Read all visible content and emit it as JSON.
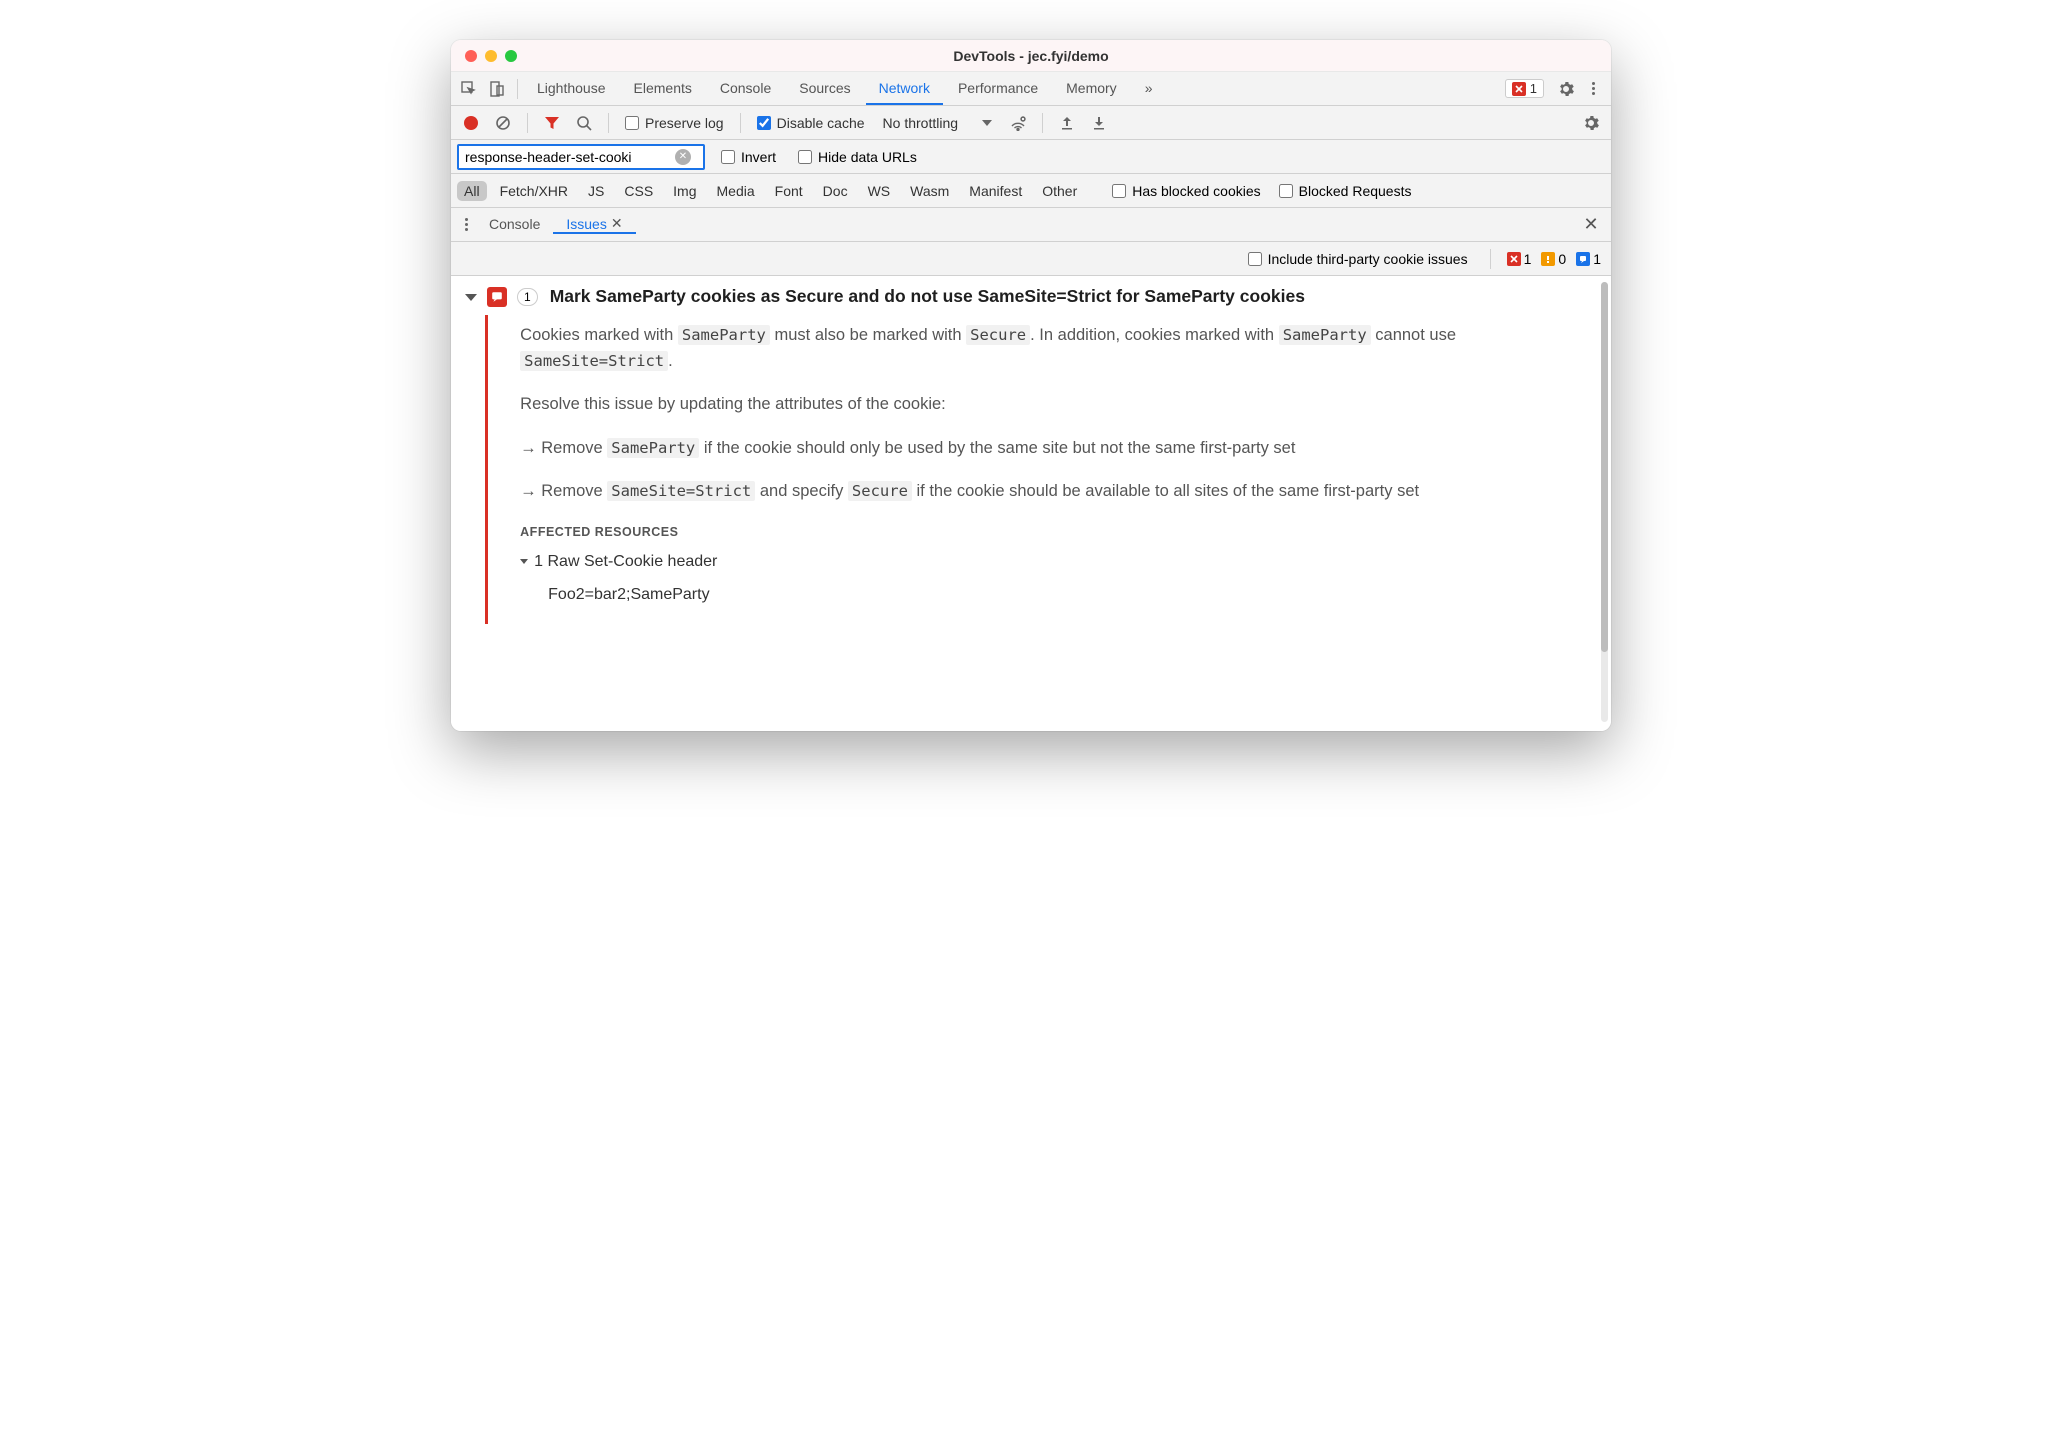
{
  "window": {
    "title": "DevTools - jec.fyi/demo"
  },
  "mainTabs": {
    "items": [
      "Lighthouse",
      "Elements",
      "Console",
      "Sources",
      "Network",
      "Performance",
      "Memory"
    ],
    "active": "Network",
    "overflow": "»",
    "errorCount": "1"
  },
  "networkToolbar": {
    "preserveLog": {
      "label": "Preserve log",
      "checked": false
    },
    "disableCache": {
      "label": "Disable cache",
      "checked": true
    },
    "throttling": "No throttling"
  },
  "filter": {
    "value": "response-header-set-cooki",
    "invert": {
      "label": "Invert",
      "checked": false
    },
    "hideDataUrls": {
      "label": "Hide data URLs",
      "checked": false
    }
  },
  "types": {
    "items": [
      "All",
      "Fetch/XHR",
      "JS",
      "CSS",
      "Img",
      "Media",
      "Font",
      "Doc",
      "WS",
      "Wasm",
      "Manifest",
      "Other"
    ],
    "active": "All",
    "hasBlockedCookies": {
      "label": "Has blocked cookies",
      "checked": false
    },
    "blockedRequests": {
      "label": "Blocked Requests",
      "checked": false
    }
  },
  "drawer": {
    "tabs": [
      "Console",
      "Issues"
    ],
    "active": "Issues"
  },
  "issuesHeader": {
    "includeThirdParty": {
      "label": "Include third-party cookie issues",
      "checked": false
    },
    "counts": {
      "error": "1",
      "warning": "0",
      "info": "1"
    }
  },
  "issue": {
    "count": "1",
    "title": "Mark SameParty cookies as Secure and do not use SameSite=Strict for SameParty cookies",
    "desc_pre1": "Cookies marked with ",
    "desc_code1": "SameParty",
    "desc_mid1": " must also be marked with ",
    "desc_code2": "Secure",
    "desc_mid2": ". In addition, cookies marked with ",
    "desc_code3": "SameParty",
    "desc_mid3": " cannot use ",
    "desc_code4": "SameSite=Strict",
    "desc_end": ".",
    "resolve": "Resolve this issue by updating the attributes of the cookie:",
    "li1_pre": "Remove ",
    "li1_code": "SameParty",
    "li1_post": " if the cookie should only be used by the same site but not the same first-party set",
    "li2_pre": "Remove ",
    "li2_code1": "SameSite=Strict",
    "li2_mid": " and specify ",
    "li2_code2": "Secure",
    "li2_post": " if the cookie should be available to all sites of the same first-party set",
    "affectedLabel": "AFFECTED RESOURCES",
    "resourceSummary": "1 Raw Set-Cookie header",
    "resourceValue": "Foo2=bar2;SameParty"
  }
}
